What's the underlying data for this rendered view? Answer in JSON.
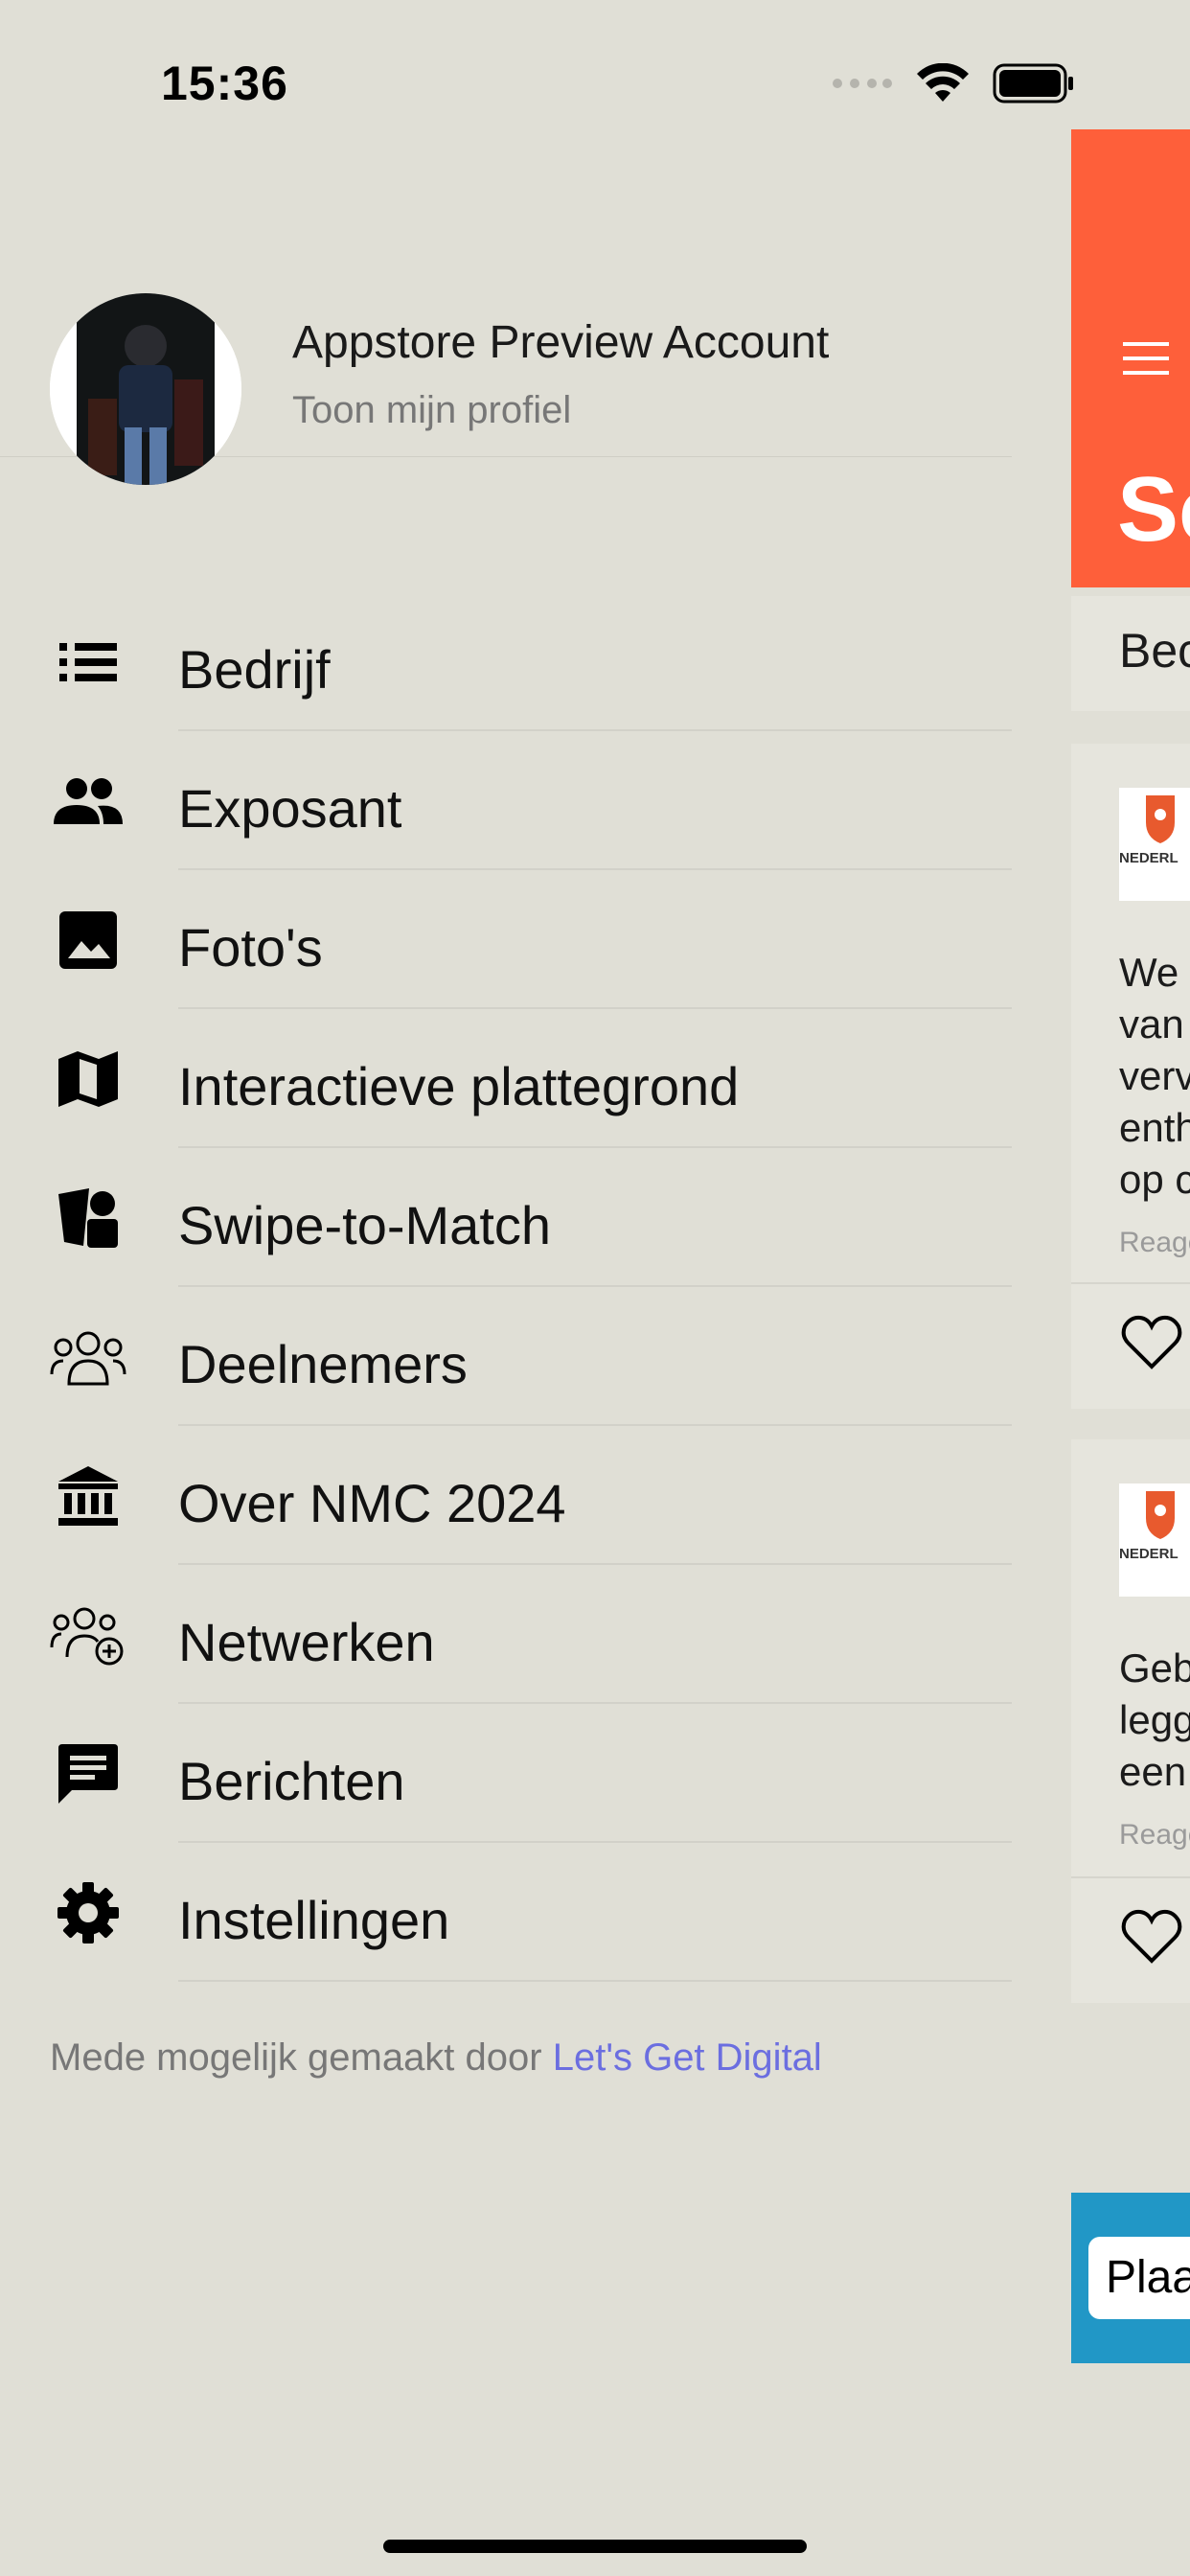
{
  "status_bar": {
    "time": "15:36"
  },
  "profile": {
    "name": "Appstore Preview Account",
    "link": "Toon mijn profiel"
  },
  "menu": [
    {
      "label": "Bedrijf",
      "icon": "list-icon"
    },
    {
      "label": "Exposant",
      "icon": "group-icon"
    },
    {
      "label": "Foto's",
      "icon": "image-icon"
    },
    {
      "label": "Interactieve plattegrond",
      "icon": "map-icon"
    },
    {
      "label": "Swipe-to-Match",
      "icon": "swipe-match-icon"
    },
    {
      "label": "Deelnemers",
      "icon": "people-icon"
    },
    {
      "label": "Over NMC 2024",
      "icon": "institution-icon"
    },
    {
      "label": "Netwerken",
      "icon": "people-add-icon"
    },
    {
      "label": "Berichten",
      "icon": "message-icon"
    },
    {
      "label": "Instellingen",
      "icon": "gear-icon"
    }
  ],
  "credit": {
    "prefix": "Mede mogelijk gemaakt door",
    "link": "Let's Get Digital"
  },
  "peek": {
    "title_fragment": "Sc",
    "tab_fragment": "Bec",
    "logo_text": "NEDERL",
    "card1_lines": [
      "We",
      "van",
      "verv",
      "enth",
      "op c"
    ],
    "card1_meta": "Reage",
    "card2_lines": [
      "Geb",
      "legg",
      "een"
    ],
    "card2_meta": "Reage",
    "button_fragment": "Plaa"
  },
  "colors": {
    "background": "#e0dfd6",
    "accent": "#fe5f3a",
    "link": "#6b6ee0",
    "bottom_bar": "#2197c6"
  }
}
